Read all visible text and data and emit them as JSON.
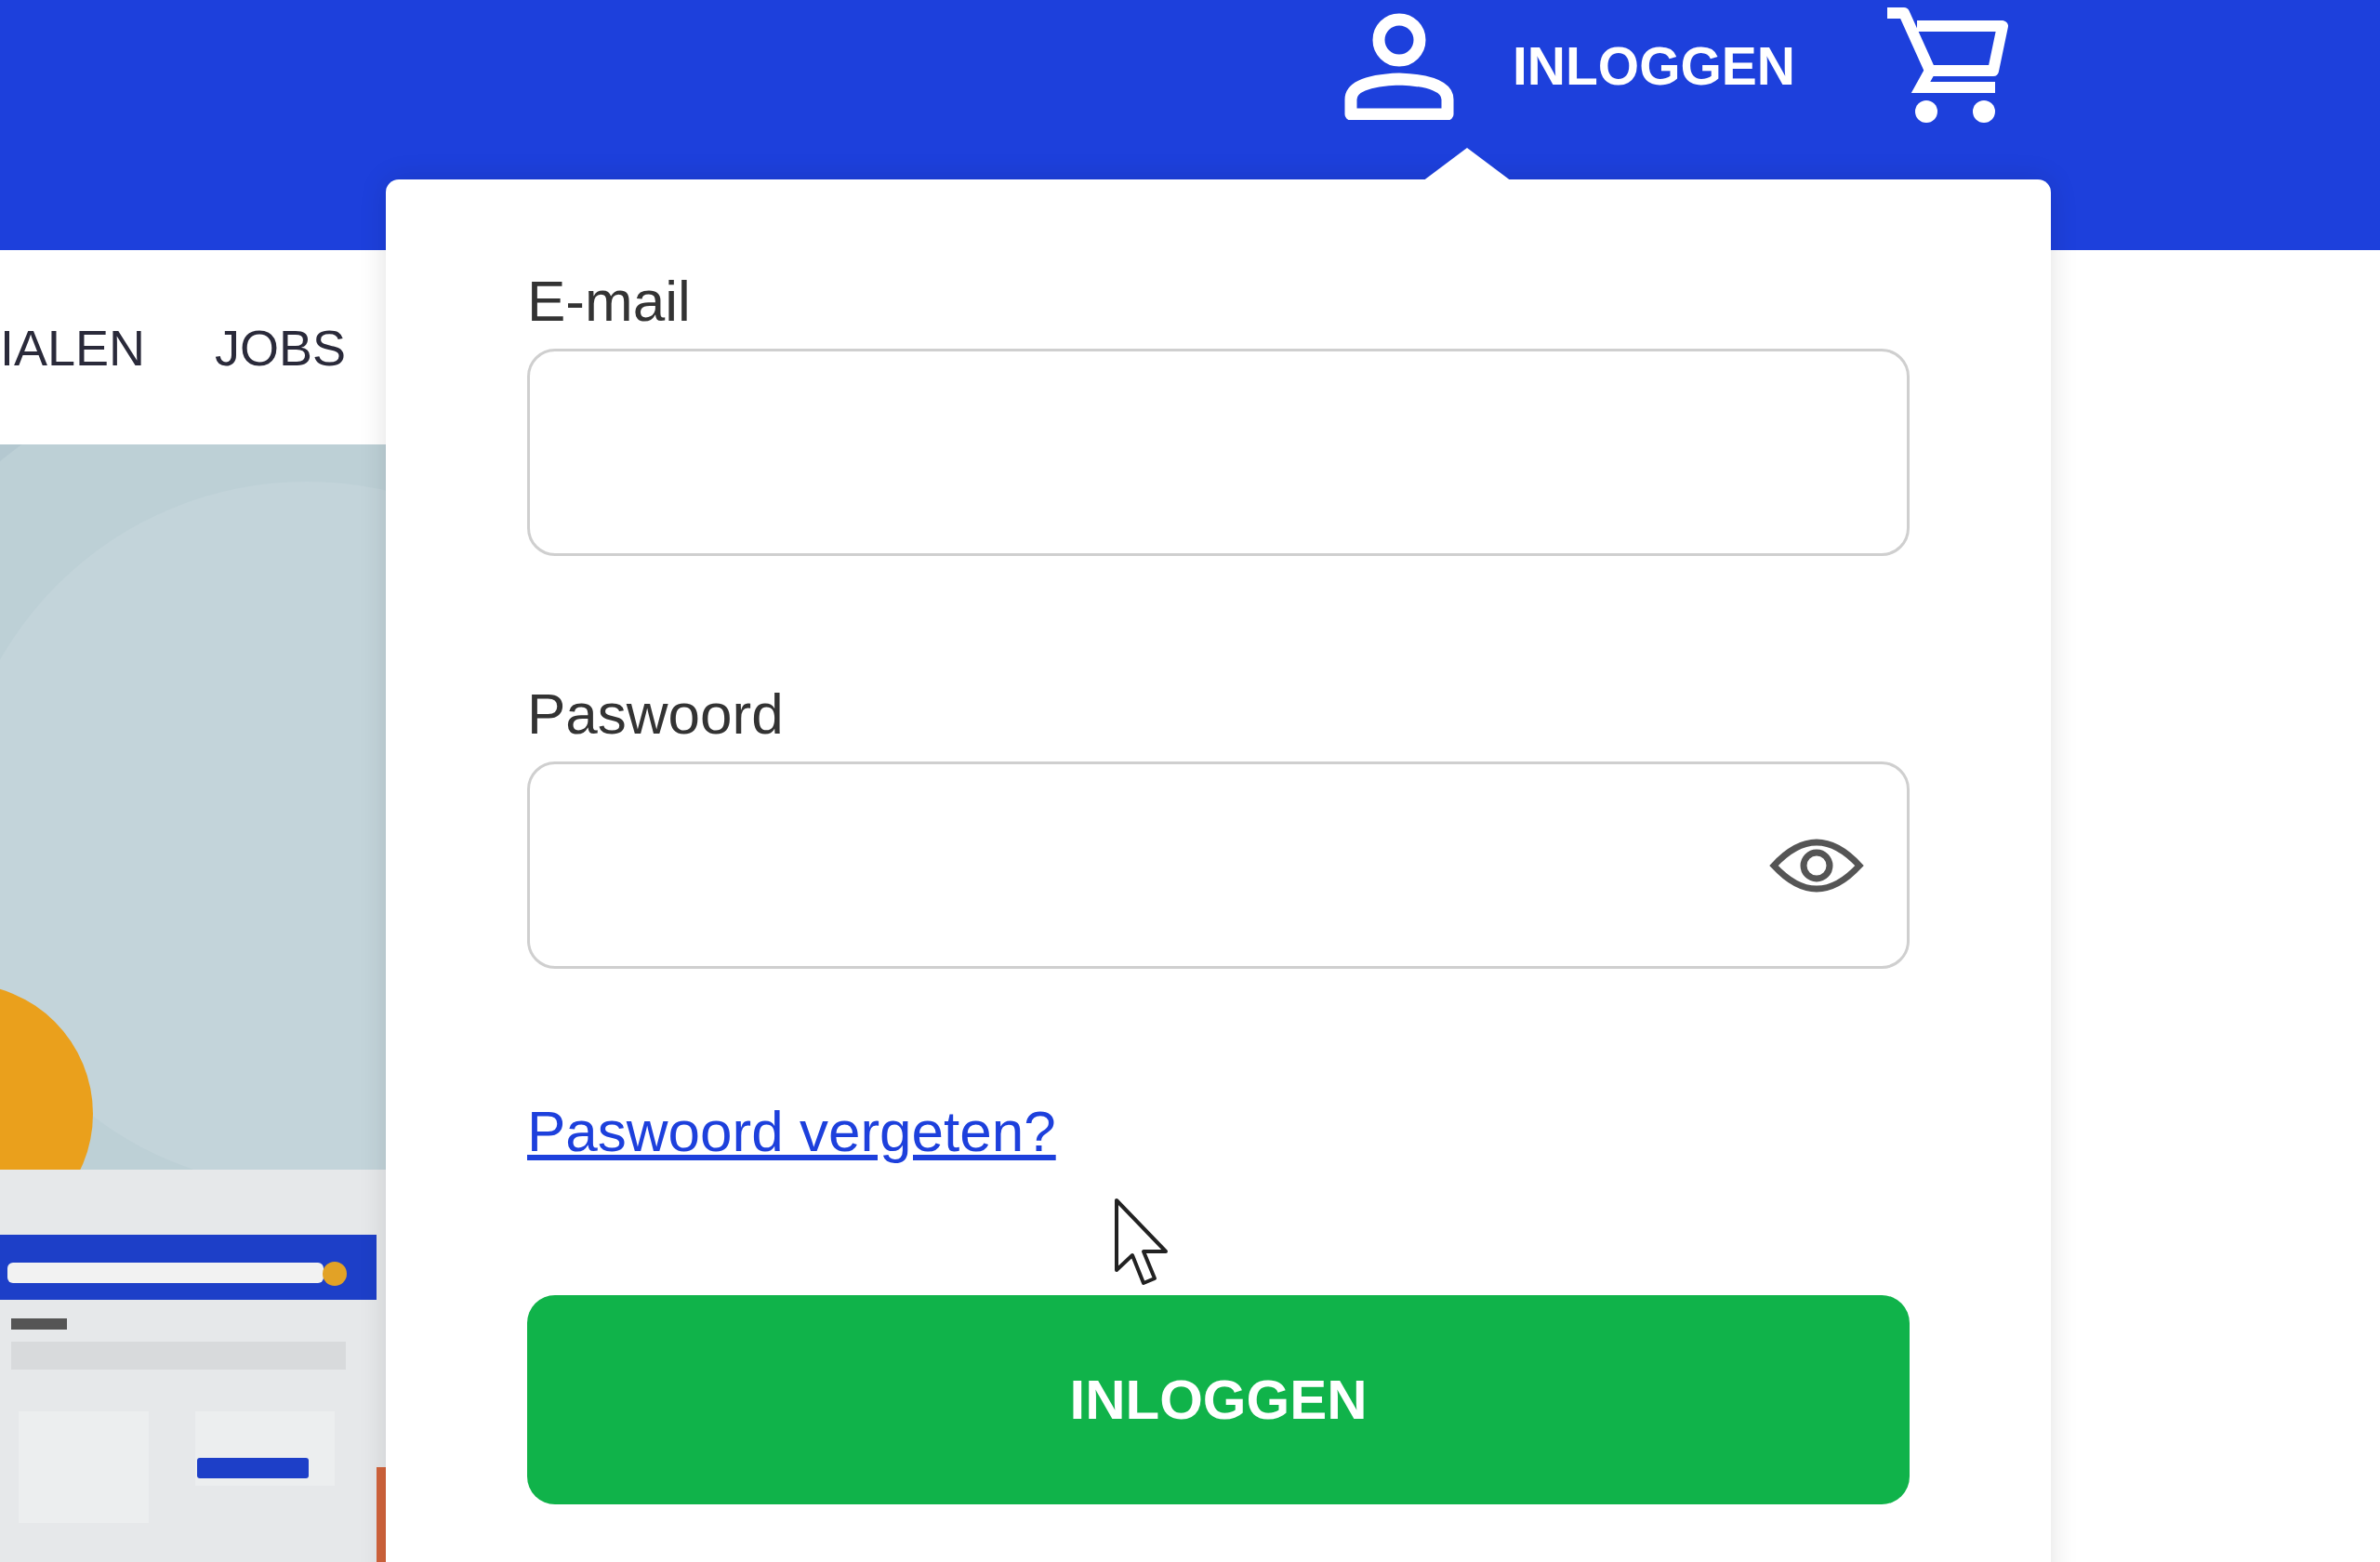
{
  "header": {
    "login_label": "INLOGGEN"
  },
  "nav": {
    "items": [
      {
        "label": "IALEN"
      },
      {
        "label": "JOBS"
      }
    ]
  },
  "login_popup": {
    "fields": [
      {
        "label": "E-mail",
        "kind": "text"
      },
      {
        "label": "Paswoord",
        "kind": "password"
      }
    ],
    "forgot_link": "Paswoord vergeten?",
    "submit": "INLOGGEN"
  }
}
